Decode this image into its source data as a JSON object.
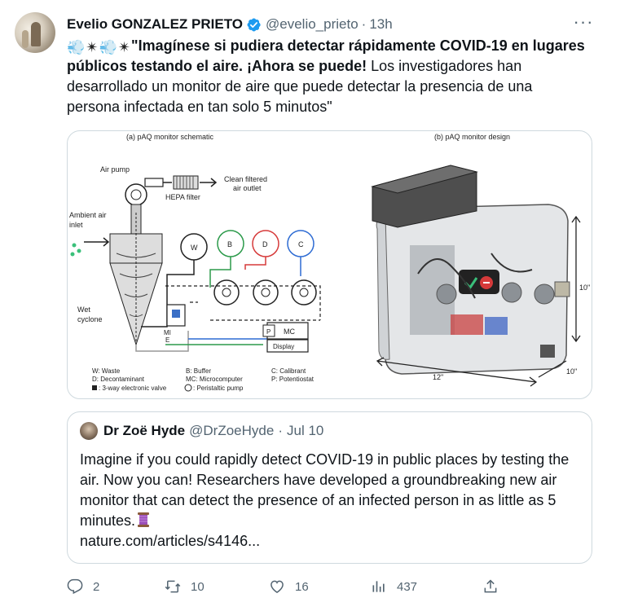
{
  "tweet": {
    "author_name": "Evelio GONZALEZ PRIETO",
    "author_handle": "@evelio_prieto",
    "separator": "·",
    "time": "13h",
    "more_label": "···",
    "text_bold": "\"Imagínese si pudiera detectar rápidamente COVID-19 en lugares públicos testando el aire. ¡Ahora se puede!",
    "text_rest": " Los investigadores han desarrollado un monitor de aire que puede detectar la presencia de una persona infectada en tan solo 5 minutos\"",
    "emoji_sequence": [
      "dash-emoji",
      "sparkle-emoji",
      "dash-emoji",
      "sparkle-emoji"
    ]
  },
  "figure": {
    "panel_a_title": "(a) pAQ monitor schematic",
    "panel_b_title": "(b) pAQ monitor design",
    "labels": {
      "air_pump": "Air pump",
      "hepa_filter": "HEPA filter",
      "clean_air": "Clean filtered",
      "clean_air_2": "air outlet",
      "ambient_air": "Ambient air",
      "ambient_air_2": "inlet",
      "wet": "Wet",
      "cyclone": "cyclone",
      "mc": "MC",
      "p": "P",
      "display": "Display",
      "me": "MI",
      "me2": "E",
      "w": "W",
      "b": "B",
      "d": "D",
      "c": "C",
      "dim_height": "10\"",
      "dim_width": "12\"",
      "dim_depth": "10\""
    },
    "legend": [
      "W: Waste",
      "B: Buffer",
      "C: Calibrant",
      "D: Decontaminant",
      "MC: Microcomputer",
      "P: Potentiostat",
      ": 3-way electronic valve",
      ": Peristaltic pump"
    ]
  },
  "quote": {
    "author_name": "Dr Zoë Hyde",
    "author_handle": "@DrZoeHyde",
    "separator": "·",
    "time": "Jul 10",
    "text": "Imagine if you could rapidly detect COVID-19 in public places by testing the air. Now you can! Researchers have developed a groundbreaking new air monitor that can detect the presence of an infected person in as little as 5 minutes.",
    "link": "nature.com/articles/s4146..."
  },
  "actions": {
    "replies": "2",
    "retweets": "10",
    "likes": "16",
    "views": "437"
  },
  "colors": {
    "text": "#0f1419",
    "secondary": "#536471",
    "border": "#cfd9de",
    "verified": "#1d9bf0"
  }
}
